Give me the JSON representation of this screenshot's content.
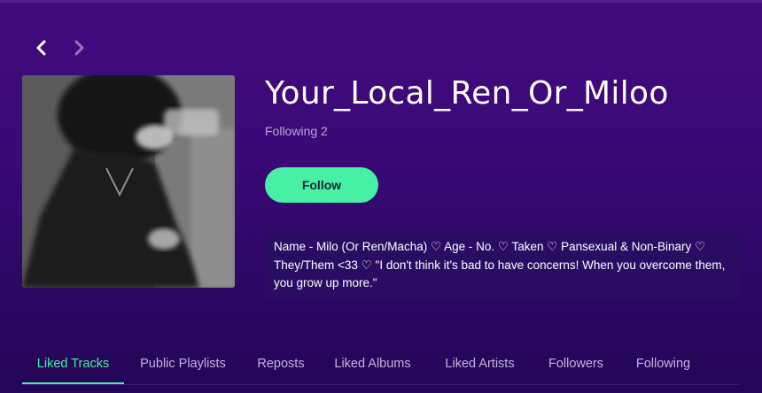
{
  "navigation": {
    "back_icon": "chevron-left-icon",
    "forward_icon": "chevron-right-icon"
  },
  "profile": {
    "name": "Your_Local_Ren_Or_Miloo",
    "following_count": "Following 2",
    "follow_label": "Follow",
    "bio": "Name - Milo (Or Ren/Macha) ♡ Age - No. ♡ Taken ♡ Pansexual & Non-Binary ♡ They/Them <33 ♡ \"I don't think it's bad to have concerns! When you overcome them, you grow up more.\""
  },
  "tabs": [
    {
      "label": "Liked Tracks",
      "active": true
    },
    {
      "label": "Public Playlists",
      "active": false
    },
    {
      "label": "Reposts",
      "active": false
    },
    {
      "label": "Liked Albums",
      "active": false
    },
    {
      "label": "Liked Artists",
      "active": false
    },
    {
      "label": "Followers",
      "active": false
    },
    {
      "label": "Following",
      "active": false
    }
  ],
  "colors": {
    "accent": "#48f0a5",
    "background": "#3a0977",
    "bio_background": "#2a0d63",
    "muted_text": "#b9a8d3"
  }
}
